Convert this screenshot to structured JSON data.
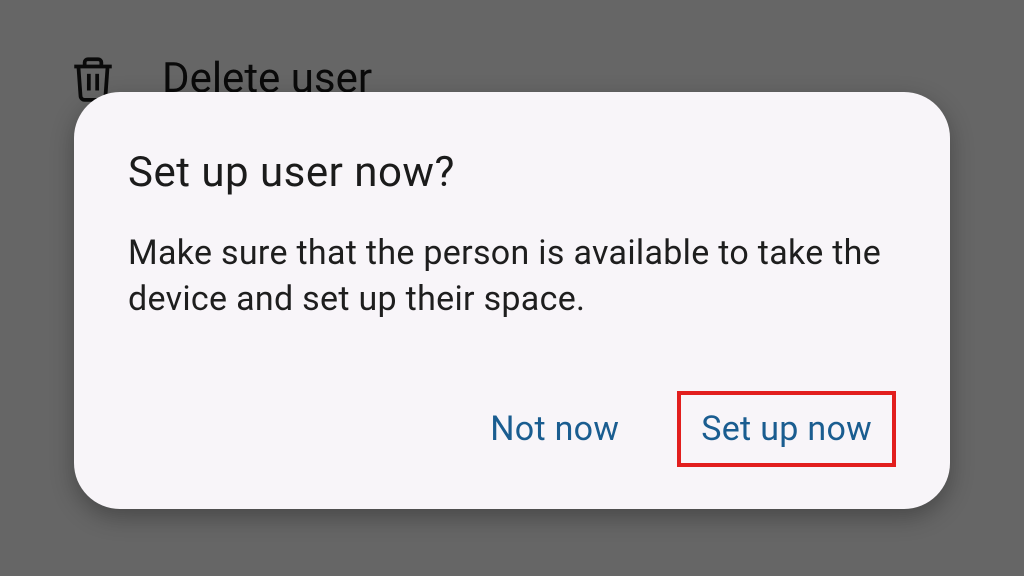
{
  "background": {
    "delete_label": "Delete user"
  },
  "dialog": {
    "title": "Set up user now?",
    "body": "Make sure that the person is available to take the device and set up their space.",
    "actions": {
      "cancel": "Not now",
      "confirm": "Set up now"
    }
  }
}
